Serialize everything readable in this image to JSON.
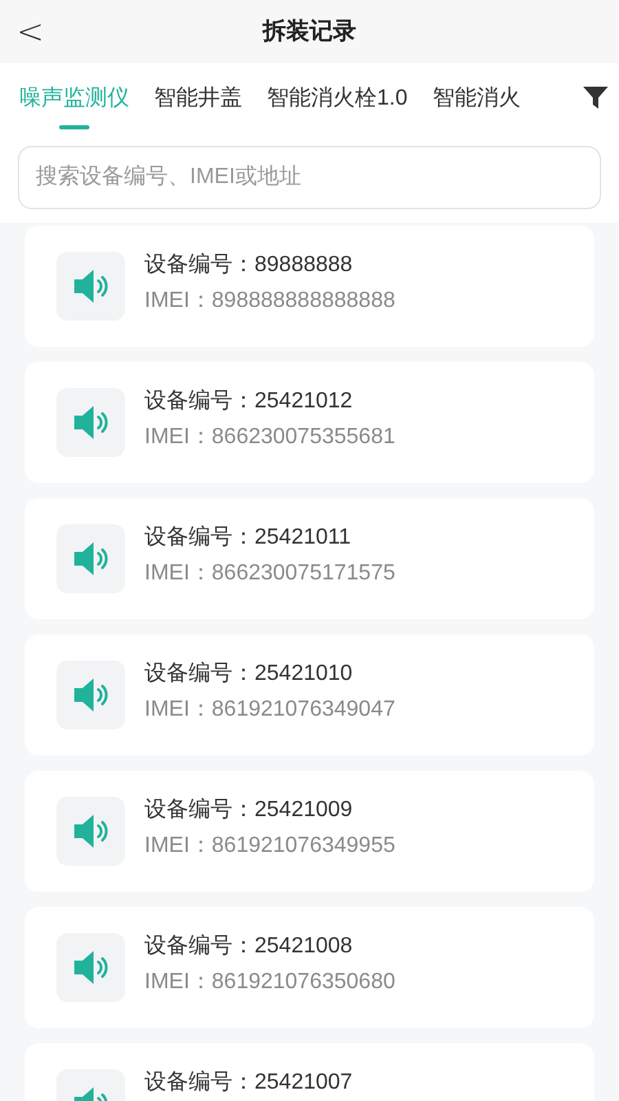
{
  "header": {
    "back": "<",
    "title": "拆装记录"
  },
  "tabs": [
    {
      "label": "噪声监测仪",
      "selected": true
    },
    {
      "label": "智能井盖",
      "selected": false
    },
    {
      "label": "智能消火栓1.0",
      "selected": false
    },
    {
      "label": "智能消火",
      "selected": false
    }
  ],
  "search": {
    "placeholder": "搜索设备编号、IMEI或地址"
  },
  "devices": [
    {
      "number": "设备编号：89888888",
      "imei": "IMEI：898888888888888"
    },
    {
      "number": "设备编号：25421012",
      "imei": "IMEI：866230075355681"
    },
    {
      "number": "设备编号：25421011",
      "imei": "IMEI：866230075171575"
    },
    {
      "number": "设备编号：25421010",
      "imei": "IMEI：861921076349047"
    },
    {
      "number": "设备编号：25421009",
      "imei": "IMEI：861921076349955"
    },
    {
      "number": "设备编号：25421008",
      "imei": "IMEI：861921076350680"
    },
    {
      "number": "设备编号：25421007"
    }
  ]
}
